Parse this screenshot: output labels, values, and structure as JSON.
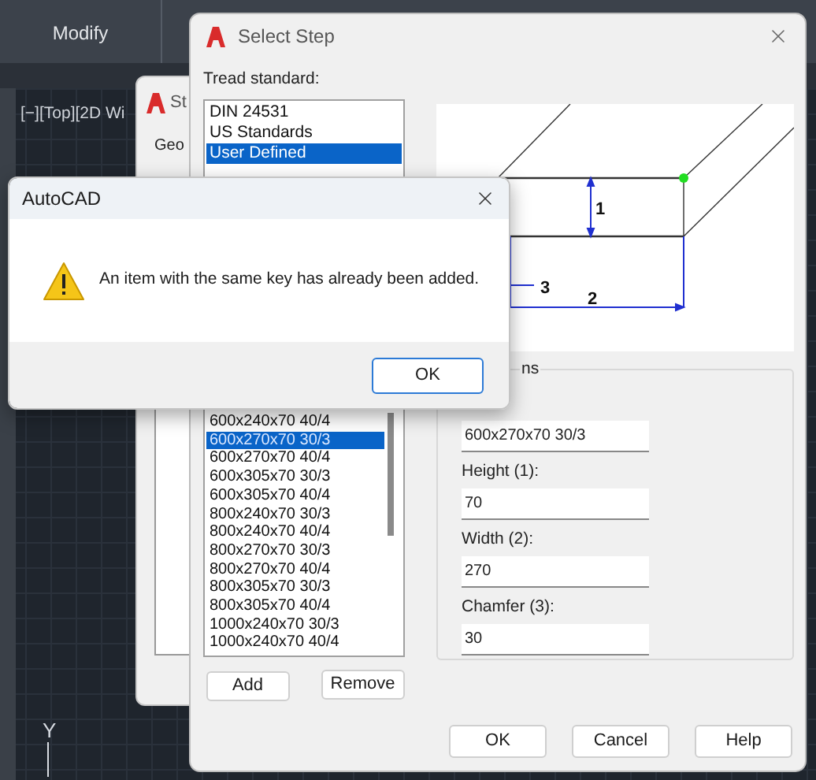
{
  "ribbon": {
    "panel_label": "Modify"
  },
  "viewport": {
    "label": "[−][Top][2D Wi",
    "axis_label": "Y"
  },
  "back_dialog": {
    "title": "St",
    "section": "Geo"
  },
  "select_step": {
    "title": "Select Step",
    "tread_label": "Tread standard:",
    "standards": [
      {
        "label": "DIN 24531",
        "selected": false
      },
      {
        "label": "US Standards",
        "selected": false
      },
      {
        "label": "User Defined",
        "selected": true
      }
    ],
    "preview": {
      "labels": [
        "1",
        "3",
        "2"
      ]
    },
    "steps": [
      {
        "label": "600x240x70 40/4",
        "selected": false
      },
      {
        "label": "600x270x70 30/3",
        "selected": true
      },
      {
        "label": "600x270x70 40/4",
        "selected": false
      },
      {
        "label": "600x305x70 30/3",
        "selected": false
      },
      {
        "label": "600x305x70 40/4",
        "selected": false
      },
      {
        "label": "800x240x70 30/3",
        "selected": false
      },
      {
        "label": "800x240x70 40/4",
        "selected": false
      },
      {
        "label": "800x270x70 30/3",
        "selected": false
      },
      {
        "label": "800x270x70 40/4",
        "selected": false
      },
      {
        "label": "800x305x70 30/3",
        "selected": false
      },
      {
        "label": "800x305x70 40/4",
        "selected": false
      },
      {
        "label": "1000x240x70 30/3",
        "selected": false
      },
      {
        "label": "1000x240x70 40/4",
        "selected": false
      }
    ],
    "add_button": "Add",
    "remove_button": "Remove",
    "dimensions_legend": "ns",
    "name_value": "600x270x70 30/3",
    "fields": [
      {
        "label": "Height (1):",
        "value": "70"
      },
      {
        "label": "Width (2):",
        "value": "270"
      },
      {
        "label": "Chamfer (3):",
        "value": "30"
      }
    ],
    "buttons": [
      "OK",
      "Cancel",
      "Help"
    ]
  },
  "message_box": {
    "title": "AutoCAD",
    "message": "An item with the same key has already been added.",
    "button": "OK"
  }
}
